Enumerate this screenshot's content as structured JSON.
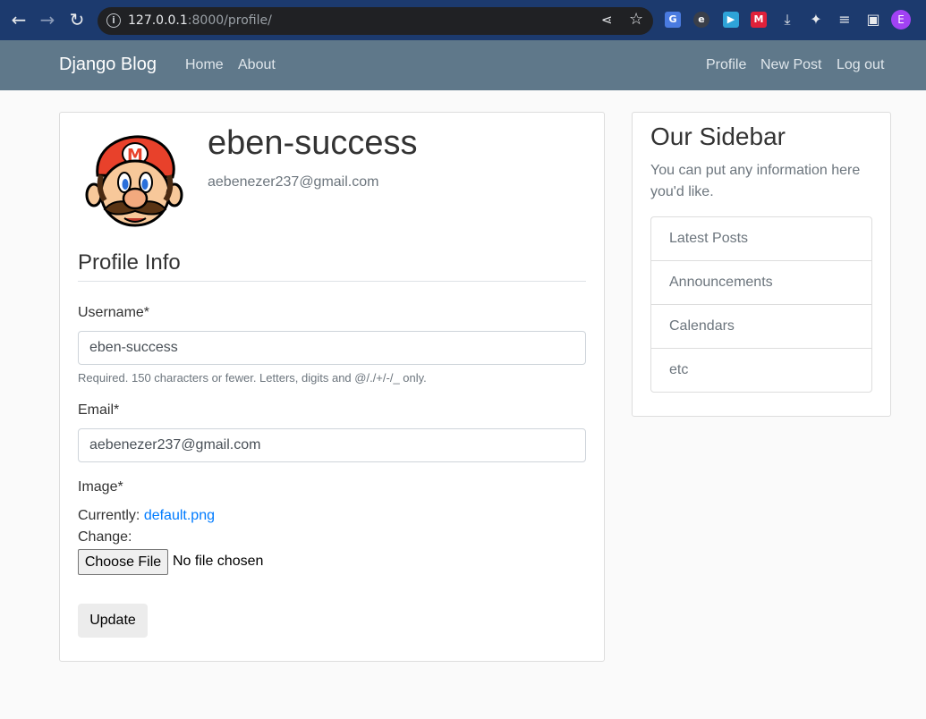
{
  "browser": {
    "url_host": "127.0.0.1",
    "url_rest": ":8000/profile/",
    "profile_initial": "E"
  },
  "navbar": {
    "brand": "Django Blog",
    "left_links": [
      "Home",
      "About"
    ],
    "right_links": [
      "Profile",
      "New Post",
      "Log out"
    ]
  },
  "profile": {
    "username": "eben-success",
    "email": "aebenezer237@gmail.com"
  },
  "form": {
    "legend": "Profile Info",
    "username_label": "Username*",
    "username_value": "eben-success",
    "username_help": "Required. 150 characters or fewer. Letters, digits and @/./+/-/_ only.",
    "email_label": "Email*",
    "email_value": "aebenezer237@gmail.com",
    "image_label": "Image*",
    "currently_label": "Currently:",
    "currently_link": "default.png",
    "change_label": "Change:",
    "choose_file": "Choose File",
    "no_file": "No file chosen",
    "submit": "Update"
  },
  "sidebar": {
    "title": "Our Sidebar",
    "text": "You can put any information here you'd like.",
    "items": [
      "Latest Posts",
      "Announcements",
      "Calendars",
      "etc"
    ]
  },
  "colors": {
    "browser_frame": "#1c3a6e",
    "navbar": "#5f788a",
    "link": "#007bff"
  }
}
